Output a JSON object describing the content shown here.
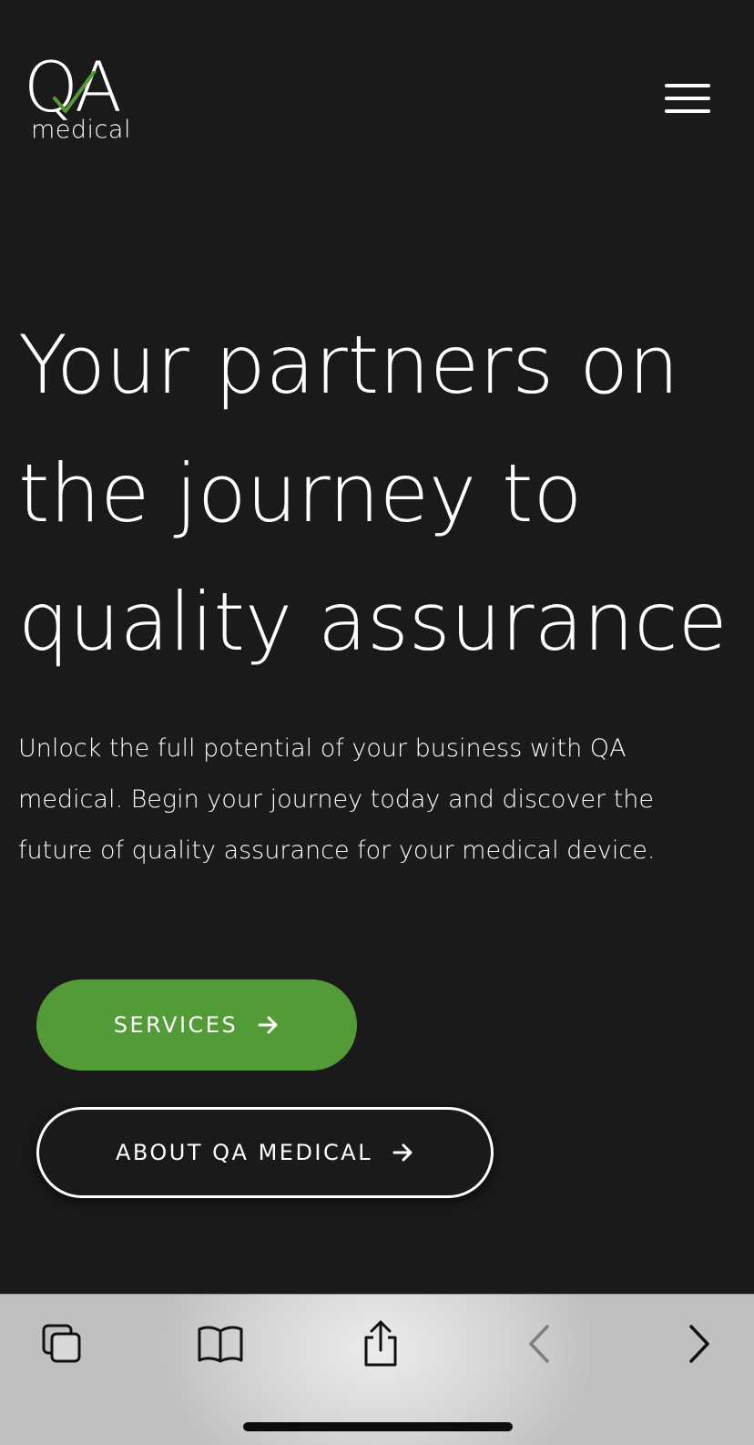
{
  "logo": {
    "main": "QA",
    "sub": "medical",
    "accent_color": "#539b37"
  },
  "header": {
    "menu_icon": "hamburger-menu-icon"
  },
  "hero": {
    "title": "Your partners on the journey to quality assurance",
    "text": "Unlock the full potential of your business with QA medical. Begin your journey today and discover the future of quality assurance for your medical device."
  },
  "buttons": {
    "services": {
      "label": "SERVICES",
      "icon": "arrow-right-icon",
      "color": "#539b37"
    },
    "about": {
      "label": "ABOUT QA MEDICAL",
      "icon": "arrow-right-icon"
    }
  },
  "colors": {
    "background": "#1a1a1a",
    "text": "#ffffff",
    "accent": "#539b37"
  },
  "browser_toolbar": {
    "icons": [
      "tabs-icon",
      "bookmarks-icon",
      "share-icon",
      "back-icon",
      "forward-icon"
    ]
  }
}
